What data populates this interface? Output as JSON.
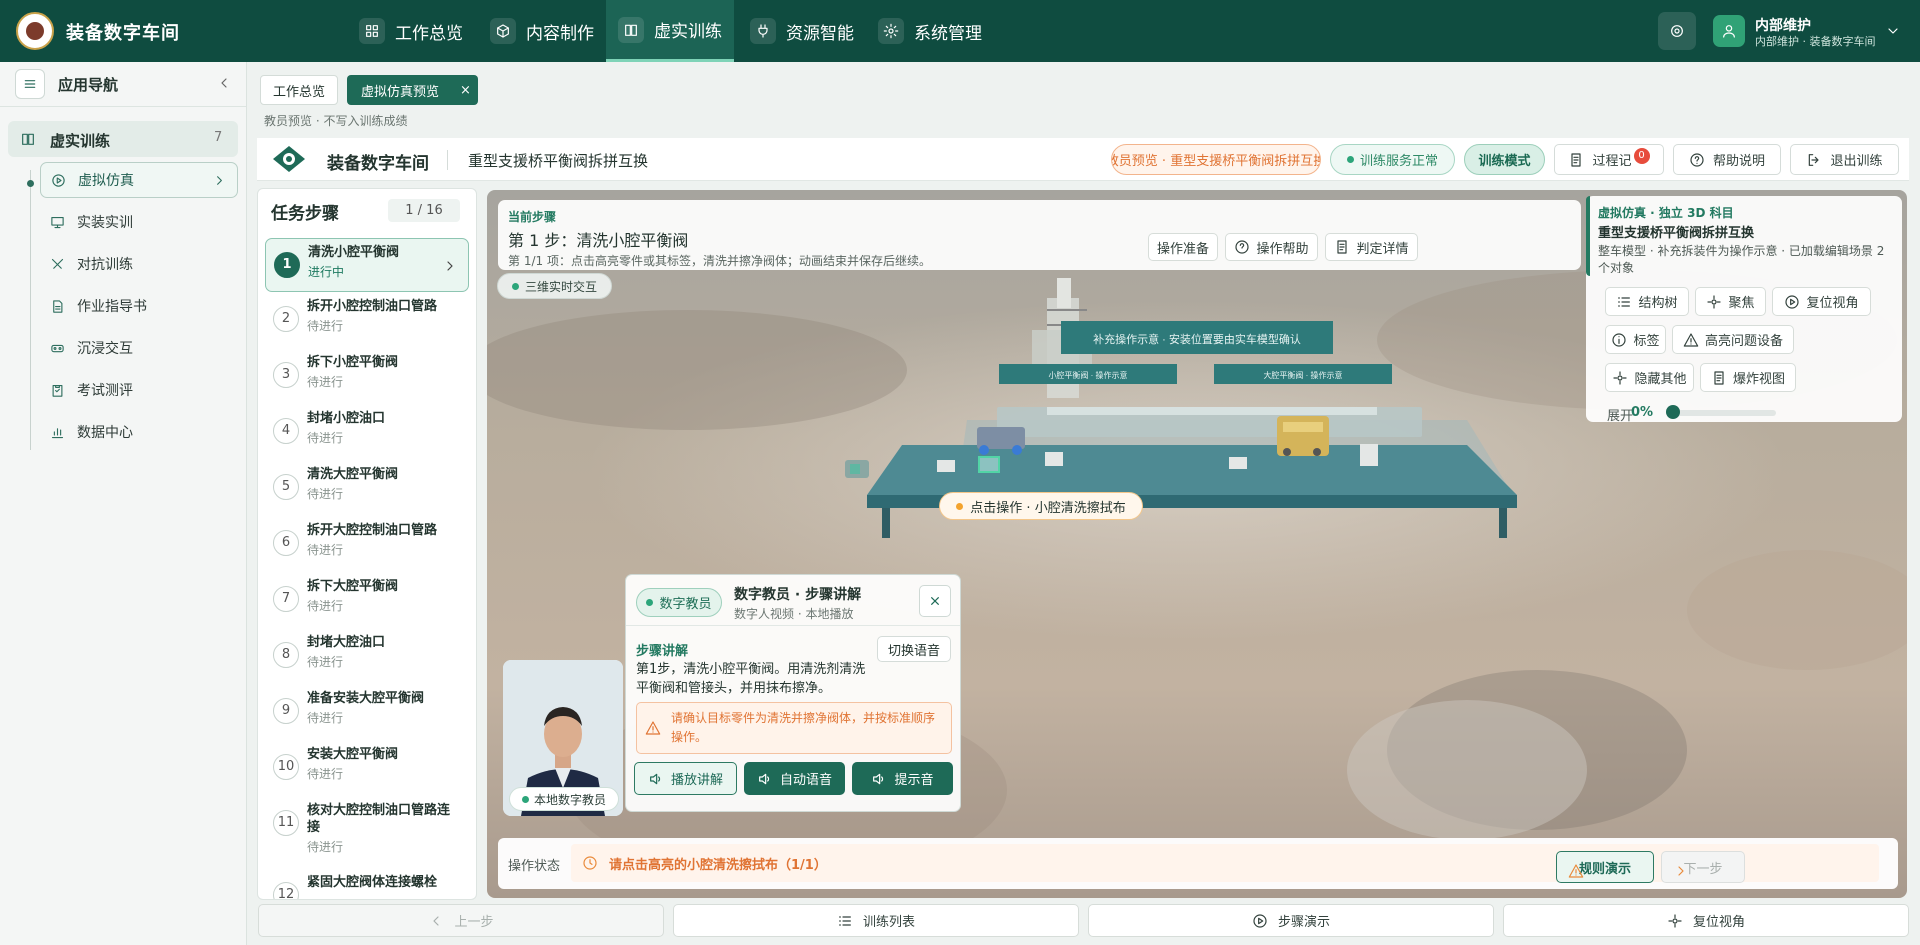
{
  "app": {
    "title": "装备数字车间"
  },
  "topnav": [
    {
      "label": "工作总览",
      "icon": "dashboard-icon"
    },
    {
      "label": "内容制作",
      "icon": "cube-icon"
    },
    {
      "label": "虚实训练",
      "icon": "book-icon"
    },
    {
      "label": "资源智能",
      "icon": "plug-icon"
    },
    {
      "label": "系统管理",
      "icon": "gear-icon"
    }
  ],
  "topnav_active": "虚实训练",
  "user": {
    "name": "内部维护",
    "sub": "内部维护 · 装备数字车间"
  },
  "sidebar": {
    "title": "应用导航",
    "group": {
      "label": "虚实训练",
      "count": "7"
    },
    "items": [
      {
        "label": "虚拟仿真",
        "icon": "play-circle-icon"
      },
      {
        "label": "实装实训",
        "icon": "monitor-icon"
      },
      {
        "label": "对抗训练",
        "icon": "swords-icon"
      },
      {
        "label": "作业指导书",
        "icon": "document-icon"
      },
      {
        "label": "沉浸交互",
        "icon": "vr-icon"
      },
      {
        "label": "考试测评",
        "icon": "clipboard-icon"
      },
      {
        "label": "数据中心",
        "icon": "chart-icon"
      }
    ]
  },
  "tabs": [
    {
      "label": "工作总览"
    },
    {
      "label": "虚拟仿真预览"
    }
  ],
  "tab_close": "×",
  "preview_note": "教员预览 · 不写入训练成绩",
  "header": {
    "brand": "装备数字车间",
    "subject": "重型支援桥平衡阀拆拼互换",
    "preview_pill": "教员预览 · 重型支援桥平衡阀拆拼互换",
    "service_pill": "训练服务正常",
    "mode_pill": "训练模式",
    "process_label": "过程记",
    "process_badge": "0",
    "help_label": "帮助说明",
    "exit_label": "退出训练"
  },
  "steps": {
    "title": "任务步骤",
    "count": "1 / 16",
    "items": [
      {
        "num": "1",
        "name": "清洗小腔平衡阀",
        "status": "进行中"
      },
      {
        "num": "2",
        "name": "拆开小腔控制油口管路",
        "status": "待进行"
      },
      {
        "num": "3",
        "name": "拆下小腔平衡阀",
        "status": "待进行"
      },
      {
        "num": "4",
        "name": "封堵小腔油口",
        "status": "待进行"
      },
      {
        "num": "5",
        "name": "清洗大腔平衡阀",
        "status": "待进行"
      },
      {
        "num": "6",
        "name": "拆开大腔控制油口管路",
        "status": "待进行"
      },
      {
        "num": "7",
        "name": "拆下大腔平衡阀",
        "status": "待进行"
      },
      {
        "num": "8",
        "name": "封堵大腔油口",
        "status": "待进行"
      },
      {
        "num": "9",
        "name": "准备安装大腔平衡阀",
        "status": "待进行"
      },
      {
        "num": "10",
        "name": "安装大腔平衡阀",
        "status": "待进行"
      },
      {
        "num": "11",
        "name": "核对大腔控制油口管路连接",
        "status": "待进行"
      },
      {
        "num": "12",
        "name": "紧固大腔阀体连接螺栓",
        "status": ""
      }
    ]
  },
  "current": {
    "label": "当前步骤",
    "title": "第 1 步：清洗小腔平衡阀",
    "desc": "第 1/1 项：点击高亮零件或其标签，清洗并擦净阀体；动画结束并保存后继续。",
    "btn_prep": "操作准备",
    "btn_help": "操作帮助",
    "btn_judge": "判定详情",
    "chip": "三维实时交互"
  },
  "object": {
    "tag": "虚拟仿真 · 独立 3D 科目",
    "title": "重型支援桥平衡阀拆拼互换",
    "desc": "整车模型 · 补充拆装件为操作示意 · 已加载编辑场景 2 个对象",
    "btn_tree": "结构树",
    "btn_focus": "聚焦",
    "btn_reset": "复位视角",
    "btn_label": "标签",
    "btn_highlight": "高亮问题设备",
    "btn_hide": "隐藏其他",
    "btn_explode": "爆炸视图",
    "explode_label": "展开",
    "explode_value": "0%",
    "explode_fraction": 0
  },
  "scene": {
    "banner": "补充操作示意 · 安装位置要由实车模型确认",
    "left_label": "小腔平衡阀 · 操作示意",
    "right_label": "大腔平衡阀 · 操作示意",
    "hint": "点击操作 · 小腔清洗擦拭布"
  },
  "tutor": {
    "badge": "数字教员",
    "title": "数字教员 · 步骤讲解",
    "sub": "数字人视频 · 本地播放",
    "section": "步骤讲解",
    "switch_voice": "切换语音",
    "text": "第1步，清洗小腔平衡阀。用清洗剂清洗平衡阀和管接头，并用抹布擦净。",
    "warning": "请确认目标零件为清洗并擦净阀体，并按标准顺序操作。",
    "btn_play": "播放讲解",
    "btn_auto": "自动语音",
    "btn_tone": "提示音",
    "avatar_label": "本地数字教员"
  },
  "op_status": {
    "label": "操作状态",
    "text": "请点击高亮的小腔清洗擦拭布（1/1）",
    "btn_demo": "规则演示",
    "btn_next": "下一步"
  },
  "bottom": {
    "prev": "上一步",
    "list": "训练列表",
    "demo": "步骤演示",
    "reset": "复位视角"
  },
  "colors": {
    "primary": "#0f4c40",
    "accent": "#1e6a57",
    "warning": "#e07434",
    "ok": "#2ca57a"
  }
}
